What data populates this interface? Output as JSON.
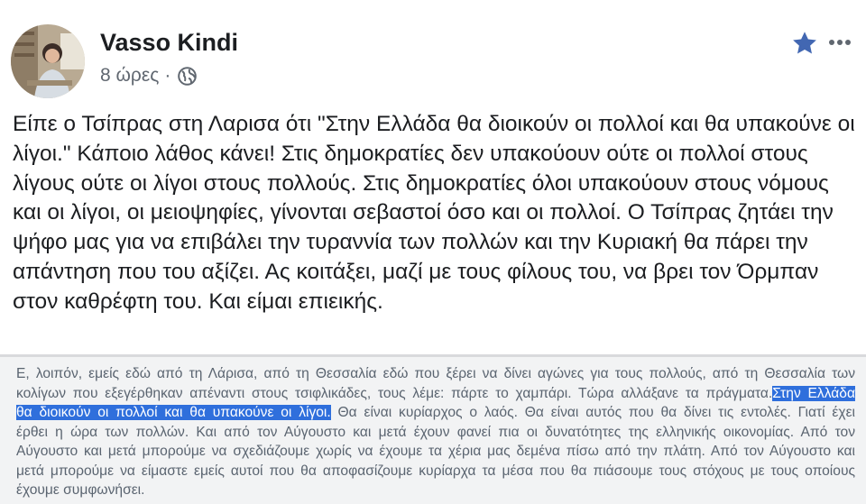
{
  "post": {
    "author_name": "Vasso Kindi",
    "time_ago": "8 ώρες",
    "separator": "·",
    "privacy_icon": "globe-icon",
    "star_icon": "star-icon",
    "more_icon": "more-options-icon",
    "text": "Είπε ο Τσίπρας στη Λαρισα ότι \"Στην Ελλάδα θα διοικούν οι πολλοί και θα υπακούνε οι λίγοι.\" Κάποιο λάθος κάνει!  Στις δημοκρατίες δεν υπακούουν ούτε οι πολλοί στους λίγους ούτε οι λίγοι στους πολλούς. Στις δημοκρατίες όλοι υπακούουν στους νόμους και οι λίγοι, οι μειοψηφίες, γίνονται σεβαστοί όσο και οι πολλοί. Ο Τσίπρας ζητάει την ψήφο μας για να επιβάλει την τυραννία των πολλών και την Κυριακή θα πάρει την απάντηση που του αξίζει. Ας κοιτάξει, μαζί με τους φίλους του, να βρει τον Όρμπαν στον καθρέφτη του. Και είμαι επιεικής."
  },
  "shared_clip": {
    "line1": "Ε, λοιπόν, εμείς εδώ από τη Λάρισα, από τη Θεσσαλία εδώ που ξέρει να δίνει αγώνες για τους πολλούς, από τη Θεσσαλία των",
    "line2_before": "κολίγων που εξεγέρθηκαν απέναντι στους τσιφλικάδες, τους λέμε: πάρτε το χαμπάρι. Τώρα αλλάξανε τα πράγματα.",
    "line2_highlight": "Στην Ελλάδα",
    "line3_highlight": "θα διοικούν οι πολλοί και θα υπακούνε οι λίγοι.",
    "line3_after": " Θα είναι κυρίαρχος ο λαός. Θα είναι αυτός που θα δίνει τις εντολές. Γιατί έχει",
    "line4": "έρθει η ώρα των πολλών. Και από τον Αύγουστο και μετά έχουν φανεί πια οι δυνατότητες της ελληνικής οικονομίας. Από τον",
    "line5": "Αύγουστο και μετά μπορούμε να σχεδιάζουμε χωρίς να έχουμε τα χέρια μας δεμένα πίσω από την πλάτη. Από τον Αύγουστο και",
    "line6": "μετά μπορούμε να είμαστε εμείς αυτοί που θα αποφασίζουμε κυρίαρχα τα μέσα που θα πιάσουμε τους στόχους με τους οποίους",
    "line7": "έχουμε συμφωνήσει."
  },
  "colors": {
    "author": "#1c1e21",
    "meta": "#606770",
    "star": "#4267b2",
    "highlight": "#2f6fdc",
    "clip_background": "#f2f3f4"
  }
}
